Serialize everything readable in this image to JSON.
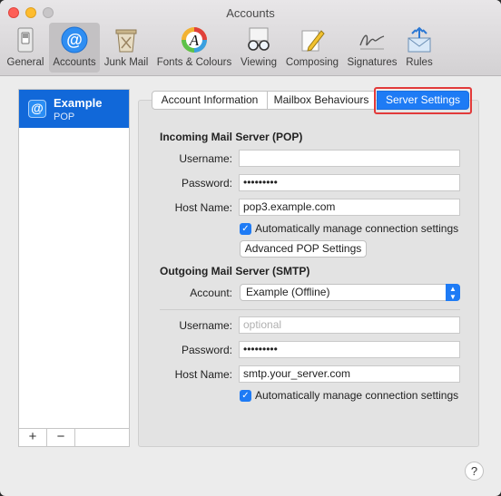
{
  "window": {
    "title": "Accounts"
  },
  "toolbar": {
    "items": [
      {
        "label": "General",
        "icon": "general-switch-icon"
      },
      {
        "label": "Accounts",
        "icon": "at-sign-icon"
      },
      {
        "label": "Junk Mail",
        "icon": "trash-bin-icon"
      },
      {
        "label": "Fonts & Colours",
        "icon": "font-color-wheel-icon"
      },
      {
        "label": "Viewing",
        "icon": "glasses-icon"
      },
      {
        "label": "Composing",
        "icon": "pencil-note-icon"
      },
      {
        "label": "Signatures",
        "icon": "signature-icon"
      },
      {
        "label": "Rules",
        "icon": "envelope-arrows-icon"
      }
    ]
  },
  "sidebar": {
    "account": {
      "name": "Example",
      "type": "POP",
      "icon_glyph": "@"
    },
    "add_label": "+",
    "remove_label": "−"
  },
  "tabs": [
    {
      "label": "Account Information"
    },
    {
      "label": "Mailbox Behaviours"
    },
    {
      "label": "Server Settings",
      "selected": true
    }
  ],
  "incoming": {
    "title": "Incoming Mail Server (POP)",
    "username_label": "Username:",
    "username_value": "",
    "password_label": "Password:",
    "password_value": "•••••••••",
    "host_label": "Host Name:",
    "host_value": "pop3.example.com",
    "auto_manage_label": "Automatically manage connection settings",
    "advanced_button": "Advanced POP Settings"
  },
  "outgoing": {
    "title": "Outgoing Mail Server (SMTP)",
    "account_label": "Account:",
    "account_value": "Example (Offline)",
    "username_label": "Username:",
    "username_placeholder": "optional",
    "password_label": "Password:",
    "password_value": "•••••••••",
    "host_label": "Host Name:",
    "host_value": "smtp.your_server.com",
    "auto_manage_label": "Automatically manage connection settings"
  },
  "help_label": "?",
  "colors": {
    "accent": "#1e7bf5",
    "highlight": "#e23a3a",
    "selection": "#1168d9"
  }
}
